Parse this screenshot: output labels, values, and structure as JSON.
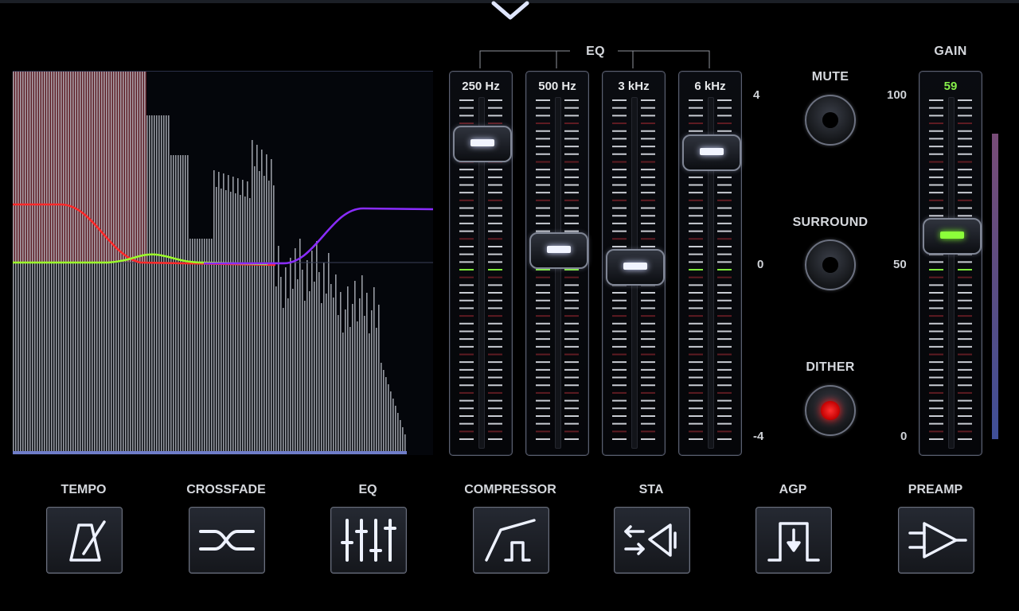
{
  "top": {
    "collapse_icon": "chevron-down-icon"
  },
  "eq_group_label": "EQ",
  "eq_scale": {
    "top": "4",
    "mid": "0",
    "bottom": "-4",
    "min": -4,
    "max": 4
  },
  "eq_bands": [
    {
      "label": "250 Hz",
      "value": 2.9
    },
    {
      "label": "500 Hz",
      "value": 0.4
    },
    {
      "label": "3 kHz",
      "value": 0.0
    },
    {
      "label": "6 kHz",
      "value": 2.7
    }
  ],
  "toggles": {
    "mute": {
      "label": "MUTE",
      "on": false
    },
    "surround": {
      "label": "SURROUND",
      "on": false
    },
    "dither": {
      "label": "DITHER",
      "on": true
    }
  },
  "gain": {
    "label": "GAIN",
    "value_text": "59",
    "value": 59,
    "scale_top": "100",
    "scale_mid": "50",
    "scale_bottom": "0"
  },
  "effects": [
    {
      "label": "TEMPO",
      "icon": "metronome-icon"
    },
    {
      "label": "CROSSFADE",
      "icon": "shuffle-icon"
    },
    {
      "label": "EQ",
      "icon": "equalizer-sliders-icon"
    },
    {
      "label": "COMPRESSOR",
      "icon": "compressor-curve-icon"
    },
    {
      "label": "STA",
      "icon": "speaker-arrows-icon"
    },
    {
      "label": "AGP",
      "icon": "gate-pulse-icon"
    },
    {
      "label": "PREAMP",
      "icon": "amplifier-icon"
    }
  ],
  "colors": {
    "eq_curve_red": "#ff2a2a",
    "eq_curve_green": "#9cff2a",
    "eq_curve_purple": "#8a2cff",
    "spectrum_bars": "#c7ccd6",
    "accent_green": "#86f04a",
    "dither_led": "#ff1a1a"
  }
}
